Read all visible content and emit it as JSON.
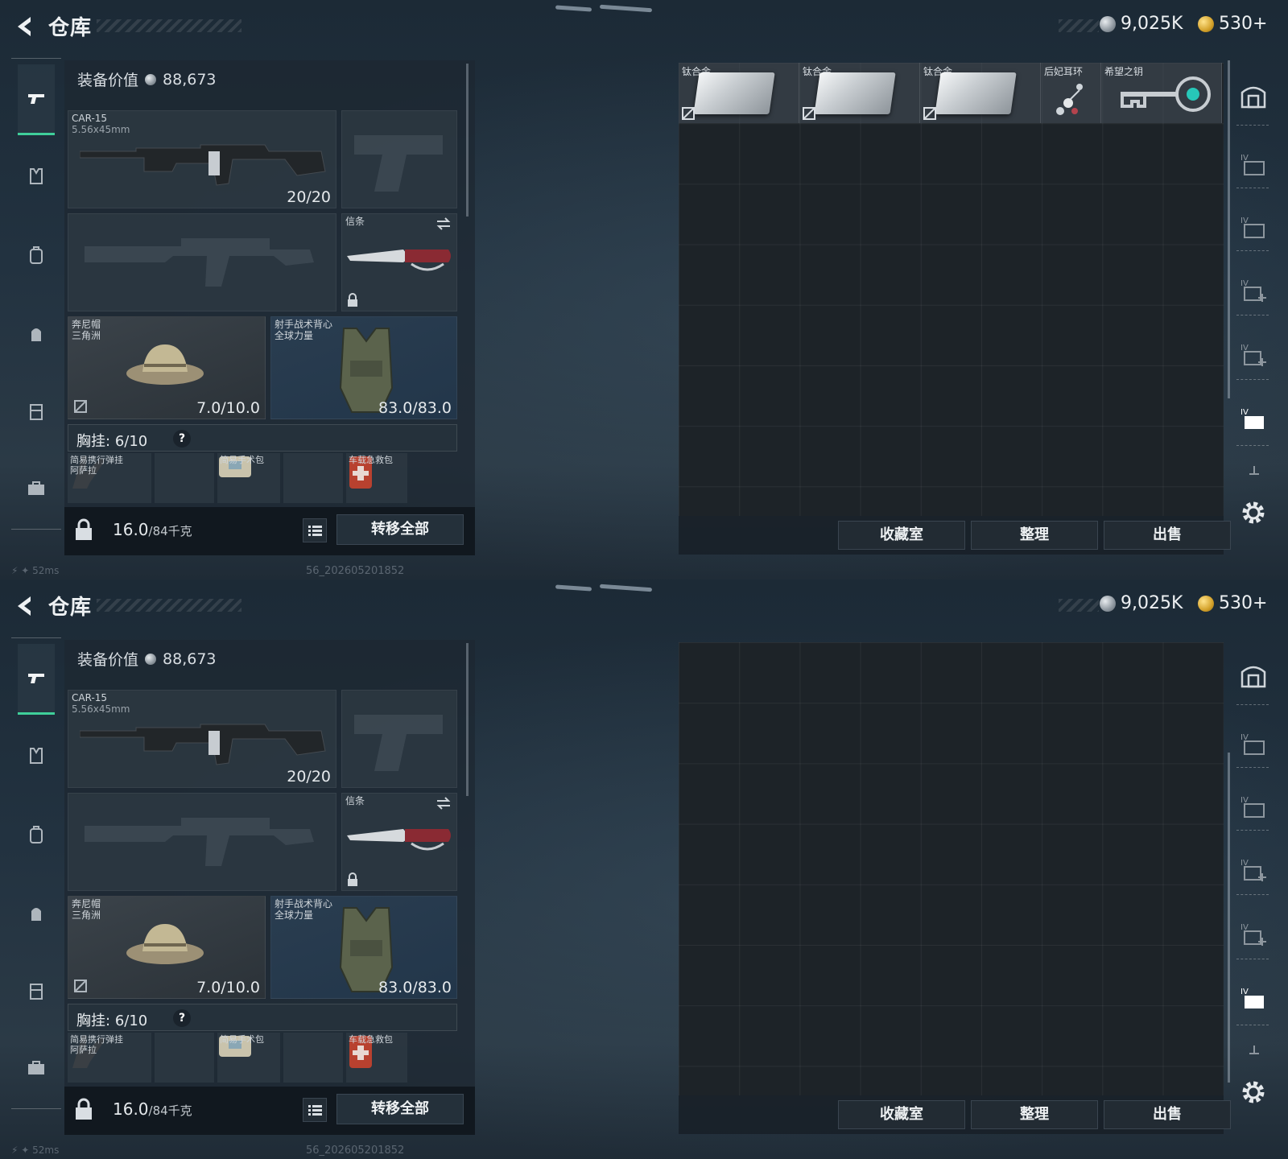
{
  "header": {
    "title": "仓库",
    "silver_amount": "9,025K",
    "gold_amount": "530+"
  },
  "equipment": {
    "value_label": "装备价值",
    "value": "88,673",
    "primary_weapon": {
      "name": "CAR-15",
      "caliber": "5.56x45mm",
      "ammo": "20/20"
    },
    "melee": {
      "name": "信条"
    },
    "helmet": {
      "name": "奔尼帽",
      "subname": "三角洲",
      "durability": "7.0/10.0"
    },
    "armor": {
      "name": "射手战术背心",
      "subname": "全球力量",
      "durability": "83.0/83.0"
    },
    "chest_rig": {
      "label": "胸挂:",
      "capacity": "6/10",
      "help": "?"
    },
    "chest_items": [
      {
        "name": "简易携行弹挂",
        "subname": "阿萨拉"
      },
      {
        "name": "简易手术包"
      },
      {
        "name": "车载急救包"
      }
    ],
    "weight": "16.0",
    "weight_max": "/84千克",
    "transfer_all": "转移全部"
  },
  "storage_panel_1": {
    "items": [
      {
        "name": "钛合金"
      },
      {
        "name": "钛合金"
      },
      {
        "name": "钛合金"
      },
      {
        "name": "后妃耳环"
      },
      {
        "name": "希望之钥"
      }
    ]
  },
  "storage_buttons": {
    "collection": "收藏室",
    "organize": "整理",
    "sell": "出售"
  },
  "status": {
    "ping": "52ms",
    "build": "56_202605201852"
  },
  "colors": {
    "accent_green": "#3fcf9a",
    "background": "#1c2a36"
  }
}
